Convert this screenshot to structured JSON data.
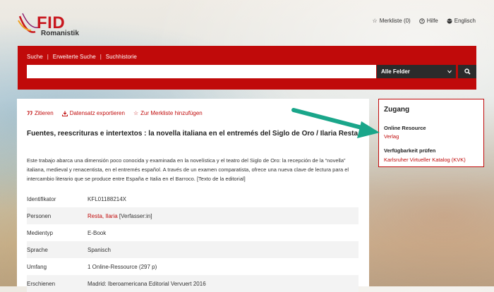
{
  "header": {
    "logo": {
      "brand": "FID",
      "subtitle": "Romanistik"
    },
    "links": [
      {
        "icon": "star-icon",
        "glyph": "☆",
        "label": "Merkliste (0)"
      },
      {
        "icon": "help-icon",
        "glyph": "?",
        "label": "Hilfe"
      },
      {
        "icon": "globe-icon",
        "glyph": "●",
        "label": "Englisch"
      }
    ]
  },
  "search": {
    "tabs": [
      "Suche",
      "Erweiterte Suche",
      "Suchhistorie"
    ],
    "input_value": "",
    "field_selected": "Alle Felder",
    "colors": {
      "bar": "#c00a0a",
      "controls": "#2b2b2b"
    }
  },
  "record": {
    "actions": [
      {
        "icon": "quote-icon",
        "label": "Zitieren"
      },
      {
        "icon": "download-icon",
        "label": "Datensatz exportieren"
      },
      {
        "icon": "star-icon",
        "label": "Zur Merkliste hinzufügen"
      }
    ],
    "title": "Fuentes, reescrituras e intertextos : la novella italiana en el entremés del Siglo de Oro / Ilaria Resta",
    "abstract": "Este trabajo abarca una dimensión poco conocida y examinada en la novelística y el teatro del Siglo de Oro: la recepción de la “novella” italiana, medieval y renacentista, en el entremés español. A través de un examen comparatista, ofrece una nueva clave de lectura para el intercambio literario que se produce entre España e Italia en el Barroco. [Texto de la editorial]",
    "details": [
      {
        "key": "Identifikator",
        "value": "KFL01188214X"
      },
      {
        "key": "Personen",
        "link": "Resta, Ilaria",
        "value": " [Verfasser:in]"
      },
      {
        "key": "Medientyp",
        "value": "E-Book"
      },
      {
        "key": "Sprache",
        "value": "Spanisch"
      },
      {
        "key": "Umfang",
        "value": "1 Online-Ressource (297 p)"
      },
      {
        "key": "Erschienen",
        "value": "Madrid: Iberoamericana Editorial Vervuert 2016"
      }
    ]
  },
  "access": {
    "heading": "Zugang",
    "online_label": "Online Resource",
    "online_link": "Verlag",
    "availability_label": "Verfügbarkeit prüfen",
    "availability_link": "Karlsruher Virtueller Katalog (KVK)",
    "accent": "#c00a0a"
  },
  "annotation": {
    "arrow_color": "#1aa68a"
  }
}
